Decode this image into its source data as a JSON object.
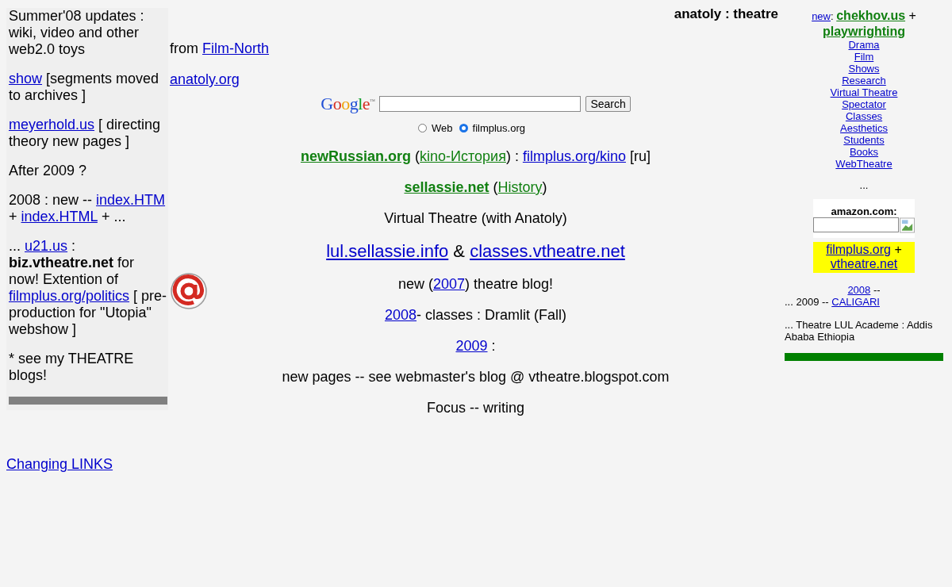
{
  "left_panel": {
    "paragraphs": [
      [
        {
          "kind": "text",
          "text": "Summer'08 updates : wiki, video and other web2.0 toys"
        }
      ],
      [
        {
          "kind": "link",
          "text": "show"
        },
        {
          "kind": "text",
          "text": " [segments moved to archives ]"
        }
      ],
      [
        {
          "kind": "link",
          "text": "meyerhold.us"
        },
        {
          "kind": "text",
          "text": " [ directing theory new pages ]"
        }
      ],
      [
        {
          "kind": "text",
          "text": "After 2009 ?"
        }
      ],
      [
        {
          "kind": "text",
          "text": "2008 : new -- "
        },
        {
          "kind": "link",
          "text": "index.HTM"
        },
        {
          "kind": "text",
          "text": " + "
        },
        {
          "kind": "link",
          "text": "index.HTML"
        },
        {
          "kind": "text",
          "text": " + ..."
        }
      ],
      [
        {
          "kind": "text",
          "text": "... "
        },
        {
          "kind": "link",
          "text": "u21.us"
        },
        {
          "kind": "text",
          "text": " : "
        },
        {
          "kind": "bold",
          "text": "biz.vtheatre.net"
        },
        {
          "kind": "text",
          "text": " for now! Extention of "
        },
        {
          "kind": "link",
          "text": "filmplus.org/politics"
        },
        {
          "kind": "text",
          "text": " [ pre-production for \"Utopia\" webshow ]"
        }
      ],
      [
        {
          "kind": "text",
          "text": "* see my THEATRE blogs!"
        }
      ]
    ]
  },
  "header": {
    "title": "anatoly : theatre"
  },
  "intro": [
    [
      {
        "kind": "text",
        "text": "from "
      },
      {
        "kind": "link",
        "text": "Film-North"
      }
    ],
    [
      {
        "kind": "link",
        "text": "anatoly.org"
      }
    ]
  ],
  "search": {
    "logo": "Google",
    "logo_mark": "™",
    "button": "Search",
    "scopes": [
      {
        "label": "Web",
        "selected": false
      },
      {
        "label": "filmplus.org",
        "selected": true
      }
    ]
  },
  "center_lines": [
    {
      "kind": "line",
      "segments": [
        {
          "kind": "featured-link",
          "text": "newRussian.org"
        },
        {
          "kind": "text",
          "text": " ("
        },
        {
          "kind": "related-link",
          "text": "kino-История"
        },
        {
          "kind": "text",
          "text": ") : "
        },
        {
          "kind": "link",
          "text": "filmplus.org/kino"
        },
        {
          "kind": "text",
          "text": " [ru]"
        }
      ]
    },
    {
      "kind": "line",
      "segments": [
        {
          "kind": "featured-link",
          "text": "sellassie.net"
        },
        {
          "kind": "text",
          "text": " ("
        },
        {
          "kind": "related-link",
          "text": "History"
        },
        {
          "kind": "text",
          "text": ")"
        }
      ]
    },
    {
      "kind": "line",
      "segments": [
        {
          "kind": "text",
          "text": "Virtual Theatre (with Anatoly)"
        }
      ]
    },
    {
      "kind": "headline",
      "segments": [
        {
          "kind": "link",
          "text": "lul.sellassie.info"
        },
        {
          "kind": "text",
          "text": " & "
        },
        {
          "kind": "link",
          "text": "classes.vtheatre.net"
        }
      ]
    },
    {
      "kind": "line",
      "segments": [
        {
          "kind": "text",
          "text": "new ("
        },
        {
          "kind": "link",
          "text": "2007"
        },
        {
          "kind": "text",
          "text": ") theatre blog!"
        }
      ]
    },
    {
      "kind": "line",
      "segments": [
        {
          "kind": "link",
          "text": "2008"
        },
        {
          "kind": "text",
          "text": "- classes : Dramlit (Fall)"
        }
      ]
    },
    {
      "kind": "line",
      "segments": [
        {
          "kind": "link",
          "text": "2009"
        },
        {
          "kind": "text",
          "text": " :"
        }
      ]
    },
    {
      "kind": "line",
      "segments": [
        {
          "kind": "text",
          "text": "new pages -- see webmaster's blog @ vtheatre.blogspot.com"
        }
      ]
    },
    {
      "kind": "line",
      "segments": [
        {
          "kind": "text",
          "text": "Focus -- writing"
        }
      ]
    }
  ],
  "footer_link": "Changing LINKS",
  "right_panel": {
    "headline": [
      {
        "kind": "small-link",
        "text": "new"
      },
      {
        "kind": "small",
        "text": ": "
      },
      {
        "kind": "featured-link",
        "text": "chekhov.us"
      },
      {
        "kind": "text",
        "text": " + "
      },
      {
        "kind": "featured-link",
        "text": "playwrighting"
      }
    ],
    "nav": [
      "Drama",
      "Film",
      "Shows",
      "Research",
      "Virtual Theatre",
      "Spectator",
      "Classes",
      "Aesthetics",
      "Students",
      "Books",
      "WebTheatre"
    ],
    "ellipsis": "...",
    "amazon": {
      "label": "amazon.com:"
    },
    "promo": [
      {
        "kind": "link",
        "text": "filmplus.org"
      },
      {
        "kind": "text",
        "text": " + "
      },
      {
        "kind": "link",
        "text": "vtheatre.net"
      }
    ],
    "archive": [
      [
        {
          "kind": "link",
          "text": "2008"
        },
        {
          "kind": "text",
          "text": " --"
        }
      ],
      [
        {
          "kind": "text",
          "text": "... 2009 -- "
        },
        {
          "kind": "link",
          "text": "CALIGARI"
        }
      ]
    ],
    "note": "... Theatre LUL Academe : Addis Ababa Ethiopia"
  }
}
